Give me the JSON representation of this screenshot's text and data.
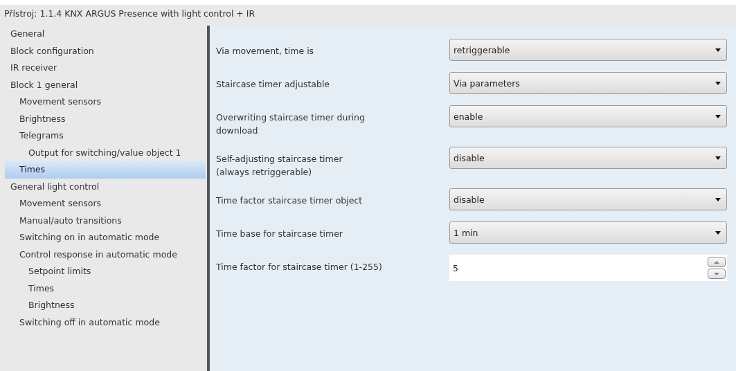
{
  "window": {
    "title": "Přístroj: 1.1.4  KNX ARGUS Presence with light control + IR"
  },
  "sidebar": {
    "items": [
      {
        "label": "General",
        "selected": false
      },
      {
        "label": "Block configuration",
        "selected": false
      },
      {
        "label": "IR receiver",
        "selected": false
      },
      {
        "label": "Block 1 general",
        "selected": false,
        "children": [
          {
            "label": "Movement sensors",
            "selected": false
          },
          {
            "label": "Brightness",
            "selected": false
          },
          {
            "label": "Telegrams",
            "selected": false,
            "children": [
              {
                "label": "Output for switching/value object 1",
                "selected": false
              }
            ]
          },
          {
            "label": "Times",
            "selected": true
          }
        ]
      },
      {
        "label": "General light control",
        "selected": false,
        "children": [
          {
            "label": "Movement sensors",
            "selected": false
          },
          {
            "label": "Manual/auto transitions",
            "selected": false
          },
          {
            "label": "Switching on in automatic mode",
            "selected": false
          },
          {
            "label": "Control response in automatic mode",
            "selected": false,
            "children": [
              {
                "label": "Setpoint limits",
                "selected": false
              },
              {
                "label": "Times",
                "selected": false
              },
              {
                "label": "Brightness",
                "selected": false
              }
            ]
          },
          {
            "label": "Switching off in automatic mode",
            "selected": false
          }
        ]
      }
    ]
  },
  "parameters": [
    {
      "kind": "dropdown",
      "label": "Via movement, time is",
      "value": "retriggerable"
    },
    {
      "kind": "dropdown",
      "label": "Staircase timer adjustable",
      "value": "Via parameters"
    },
    {
      "kind": "dropdown",
      "label": "Overwriting staircase timer during\ndownload",
      "value": "enable"
    },
    {
      "kind": "dropdown",
      "label": "Self-adjusting staircase timer\n(always retriggerable)",
      "value": "disable"
    },
    {
      "kind": "dropdown",
      "label": "Time factor staircase timer object",
      "value": "disable"
    },
    {
      "kind": "dropdown",
      "label": "Time base for staircase timer",
      "value": "1 min"
    },
    {
      "kind": "spin",
      "label": "Time factor for staircase timer (1-255)",
      "value": "5"
    }
  ]
}
